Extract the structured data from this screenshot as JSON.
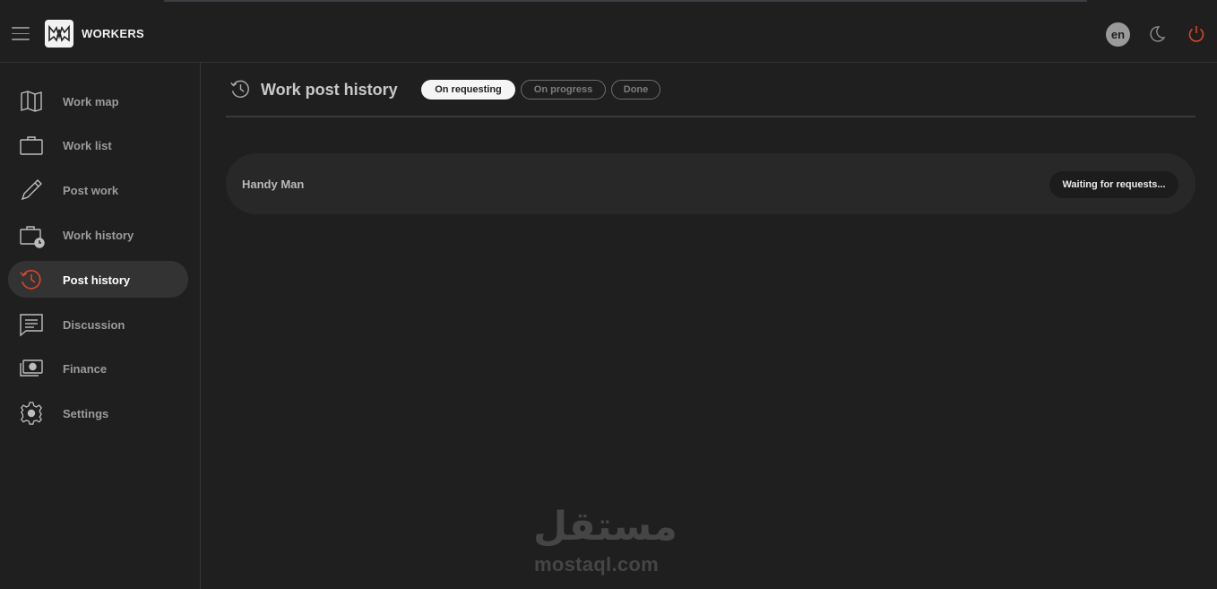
{
  "header": {
    "brand": "WORKERS",
    "language": "en",
    "icons": [
      "menu-icon",
      "workers-logo-icon",
      "moon-icon",
      "power-icon"
    ]
  },
  "sidebar": {
    "items": [
      {
        "label": "Work map",
        "icon": "map-icon"
      },
      {
        "label": "Work list",
        "icon": "briefcase-icon"
      },
      {
        "label": "Post work",
        "icon": "pencil-icon"
      },
      {
        "label": "Work history",
        "icon": "briefcase-clock-icon"
      },
      {
        "label": "Post history",
        "icon": "history-icon",
        "active": true
      },
      {
        "label": "Discussion",
        "icon": "chat-icon"
      },
      {
        "label": "Finance",
        "icon": "money-icon"
      },
      {
        "label": "Settings",
        "icon": "gear-icon"
      }
    ]
  },
  "main": {
    "title": "Work post history",
    "filters": [
      {
        "label": "On requesting",
        "active": true
      },
      {
        "label": "On progress",
        "active": false
      },
      {
        "label": "Done",
        "active": false
      }
    ],
    "posts": [
      {
        "title": "Handy Man",
        "status": "Waiting for requests..."
      }
    ]
  },
  "watermark": {
    "arabic": "مستقل",
    "text": "mostaql.com"
  },
  "colors": {
    "background": "#1f1f1f",
    "accent_red": "#d9452c",
    "active_item": "#333333",
    "card": "#282828"
  }
}
